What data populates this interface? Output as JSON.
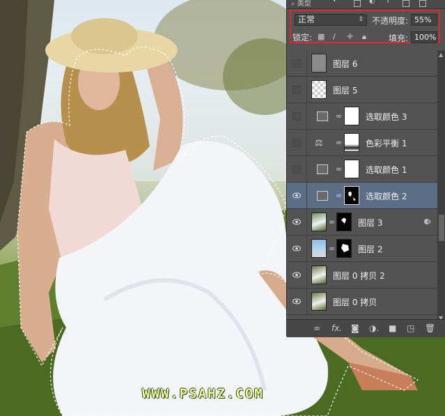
{
  "watermark": "WWW.PSAHZ.COM",
  "panel": {
    "kind_label": "类型",
    "blend_mode": "正常",
    "opacity_label": "不透明度:",
    "opacity_value": "55%",
    "lock_label": "锁定:",
    "fill_label": "填充:",
    "fill_value": "100%",
    "layers": [
      {
        "name": "图层 6",
        "visible": false,
        "thumb": "gray"
      },
      {
        "name": "图层 5",
        "visible": false,
        "thumb": "transparent"
      },
      {
        "name": "选取颜色 3",
        "visible": false,
        "thumb": "adjust-mask-white"
      },
      {
        "name": "色彩平衡 1",
        "visible": false,
        "thumb": "balance-mask"
      },
      {
        "name": "选取颜色 1",
        "visible": false,
        "thumb": "adjust-mask-white"
      },
      {
        "name": "选取颜色 2",
        "visible": true,
        "thumb": "adjust-mask-black",
        "selected": true
      },
      {
        "name": "图层 3",
        "visible": true,
        "thumb": "photo-mask"
      },
      {
        "name": "图层 2",
        "visible": true,
        "thumb": "photo-mask-sky"
      },
      {
        "name": "图层 0 拷贝 2",
        "visible": true,
        "thumb": "photo"
      },
      {
        "name": "图层 0 拷贝",
        "visible": true,
        "thumb": "photo"
      }
    ],
    "bottom_icons": [
      "link-icon",
      "fx-icon",
      "mask-icon",
      "adjustment-icon",
      "folder-icon",
      "new-layer-icon",
      "trash-icon"
    ]
  },
  "colors": {
    "accent_highlight": "#e02a2a",
    "selected_row": "#5b6e86",
    "panel_bg": "#535353"
  }
}
